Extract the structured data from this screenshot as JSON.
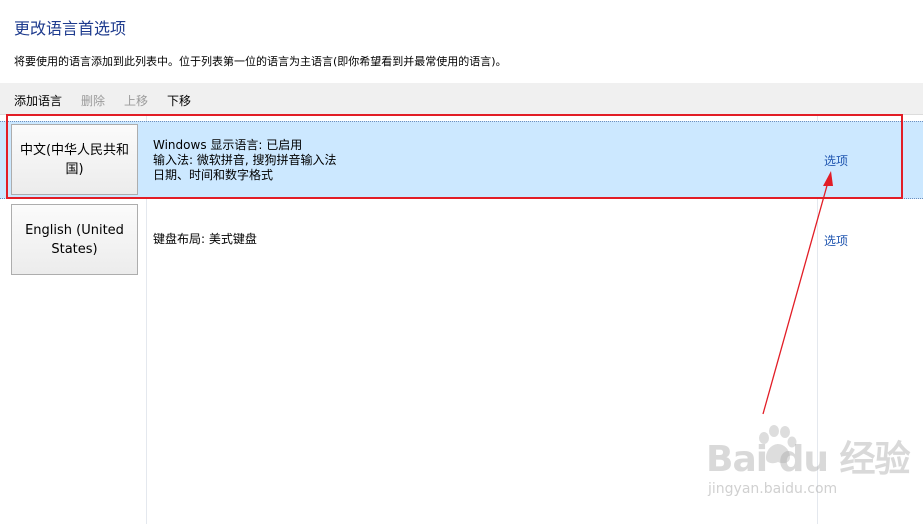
{
  "page": {
    "title": "更改语言首选项",
    "description": "将要使用的语言添加到此列表中。位于列表第一位的语言为主语言(即你希望看到并最常使用的语言)。"
  },
  "toolbar": {
    "add": "添加语言",
    "remove": "删除",
    "move_up": "上移",
    "move_down": "下移"
  },
  "languages": [
    {
      "name": "中文(中华人民共和国)",
      "details": [
        "Windows 显示语言: 已启用",
        "输入法: 微软拼音, 搜狗拼音输入法",
        "日期、时间和数字格式"
      ],
      "options_label": "选项",
      "selected": true
    },
    {
      "name": "English (United States)",
      "details": [
        "键盘布局: 美式键盘"
      ],
      "options_label": "选项",
      "selected": false
    }
  ],
  "colors": {
    "title": "#1e3b8e",
    "selection": "#cce8ff",
    "link": "#1f55b0",
    "annotation": "#e21d26"
  },
  "watermark": {
    "brand": "Bai du 经验",
    "url": "jingyan.baidu.com"
  }
}
